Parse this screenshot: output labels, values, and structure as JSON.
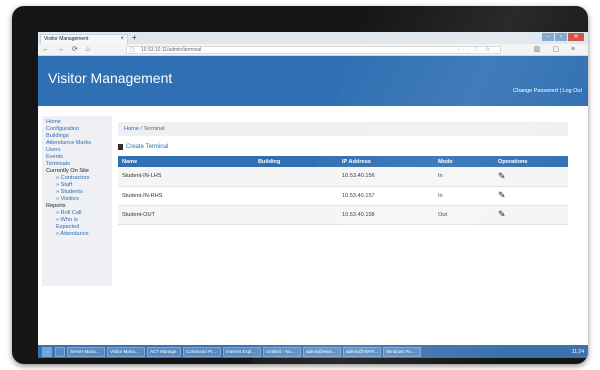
{
  "browser": {
    "tab_title": "Visitor Management",
    "tab_close": "×",
    "new_tab": "+",
    "url": "10.53.10.11/admin/terminal",
    "win_controls": [
      "–",
      "▫",
      "✕"
    ]
  },
  "app": {
    "title": "Visitor Management",
    "change_password": "Change Password",
    "separator": "|",
    "logout": "Log Out"
  },
  "sidebar": {
    "items": [
      "Home",
      "Configuration",
      "Buildings",
      "Attendance Marks",
      "Users",
      "Events",
      "Terminals"
    ],
    "currently_on_site": {
      "label": "Currently On Site",
      "items": [
        "» Contractors",
        "» Staff",
        "» Students",
        "» Visitors"
      ]
    },
    "reports": {
      "label": "Reports",
      "items": [
        "» Roll Call",
        "» Who is Expected",
        "» Attendance"
      ]
    }
  },
  "breadcrumb": {
    "home": "Home",
    "sep": "/",
    "current": "Terminal"
  },
  "actions": {
    "create": "Create Terminal"
  },
  "table": {
    "headers": [
      "Name",
      "Building",
      "IP Address",
      "Mode",
      "Operations"
    ],
    "rows": [
      {
        "name": "Student-IN-LHS",
        "building": "",
        "ip": "10.53.40.156",
        "mode": "In"
      },
      {
        "name": "Student-IN-RHS",
        "building": "",
        "ip": "10.53.40.157",
        "mode": "In"
      },
      {
        "name": "Student-OUT",
        "building": "",
        "ip": "10.53.40.158",
        "mode": "Out"
      }
    ]
  },
  "taskbar": {
    "items": [
      "Server Mana...",
      "Visitor Mana...",
      "ACT Manage",
      "Command Pr...",
      "Internet Expl...",
      "Untitled - No...",
      "admin@vism...",
      "admin@VM-R...",
      "Windows Po..."
    ],
    "clock": "11:24"
  }
}
